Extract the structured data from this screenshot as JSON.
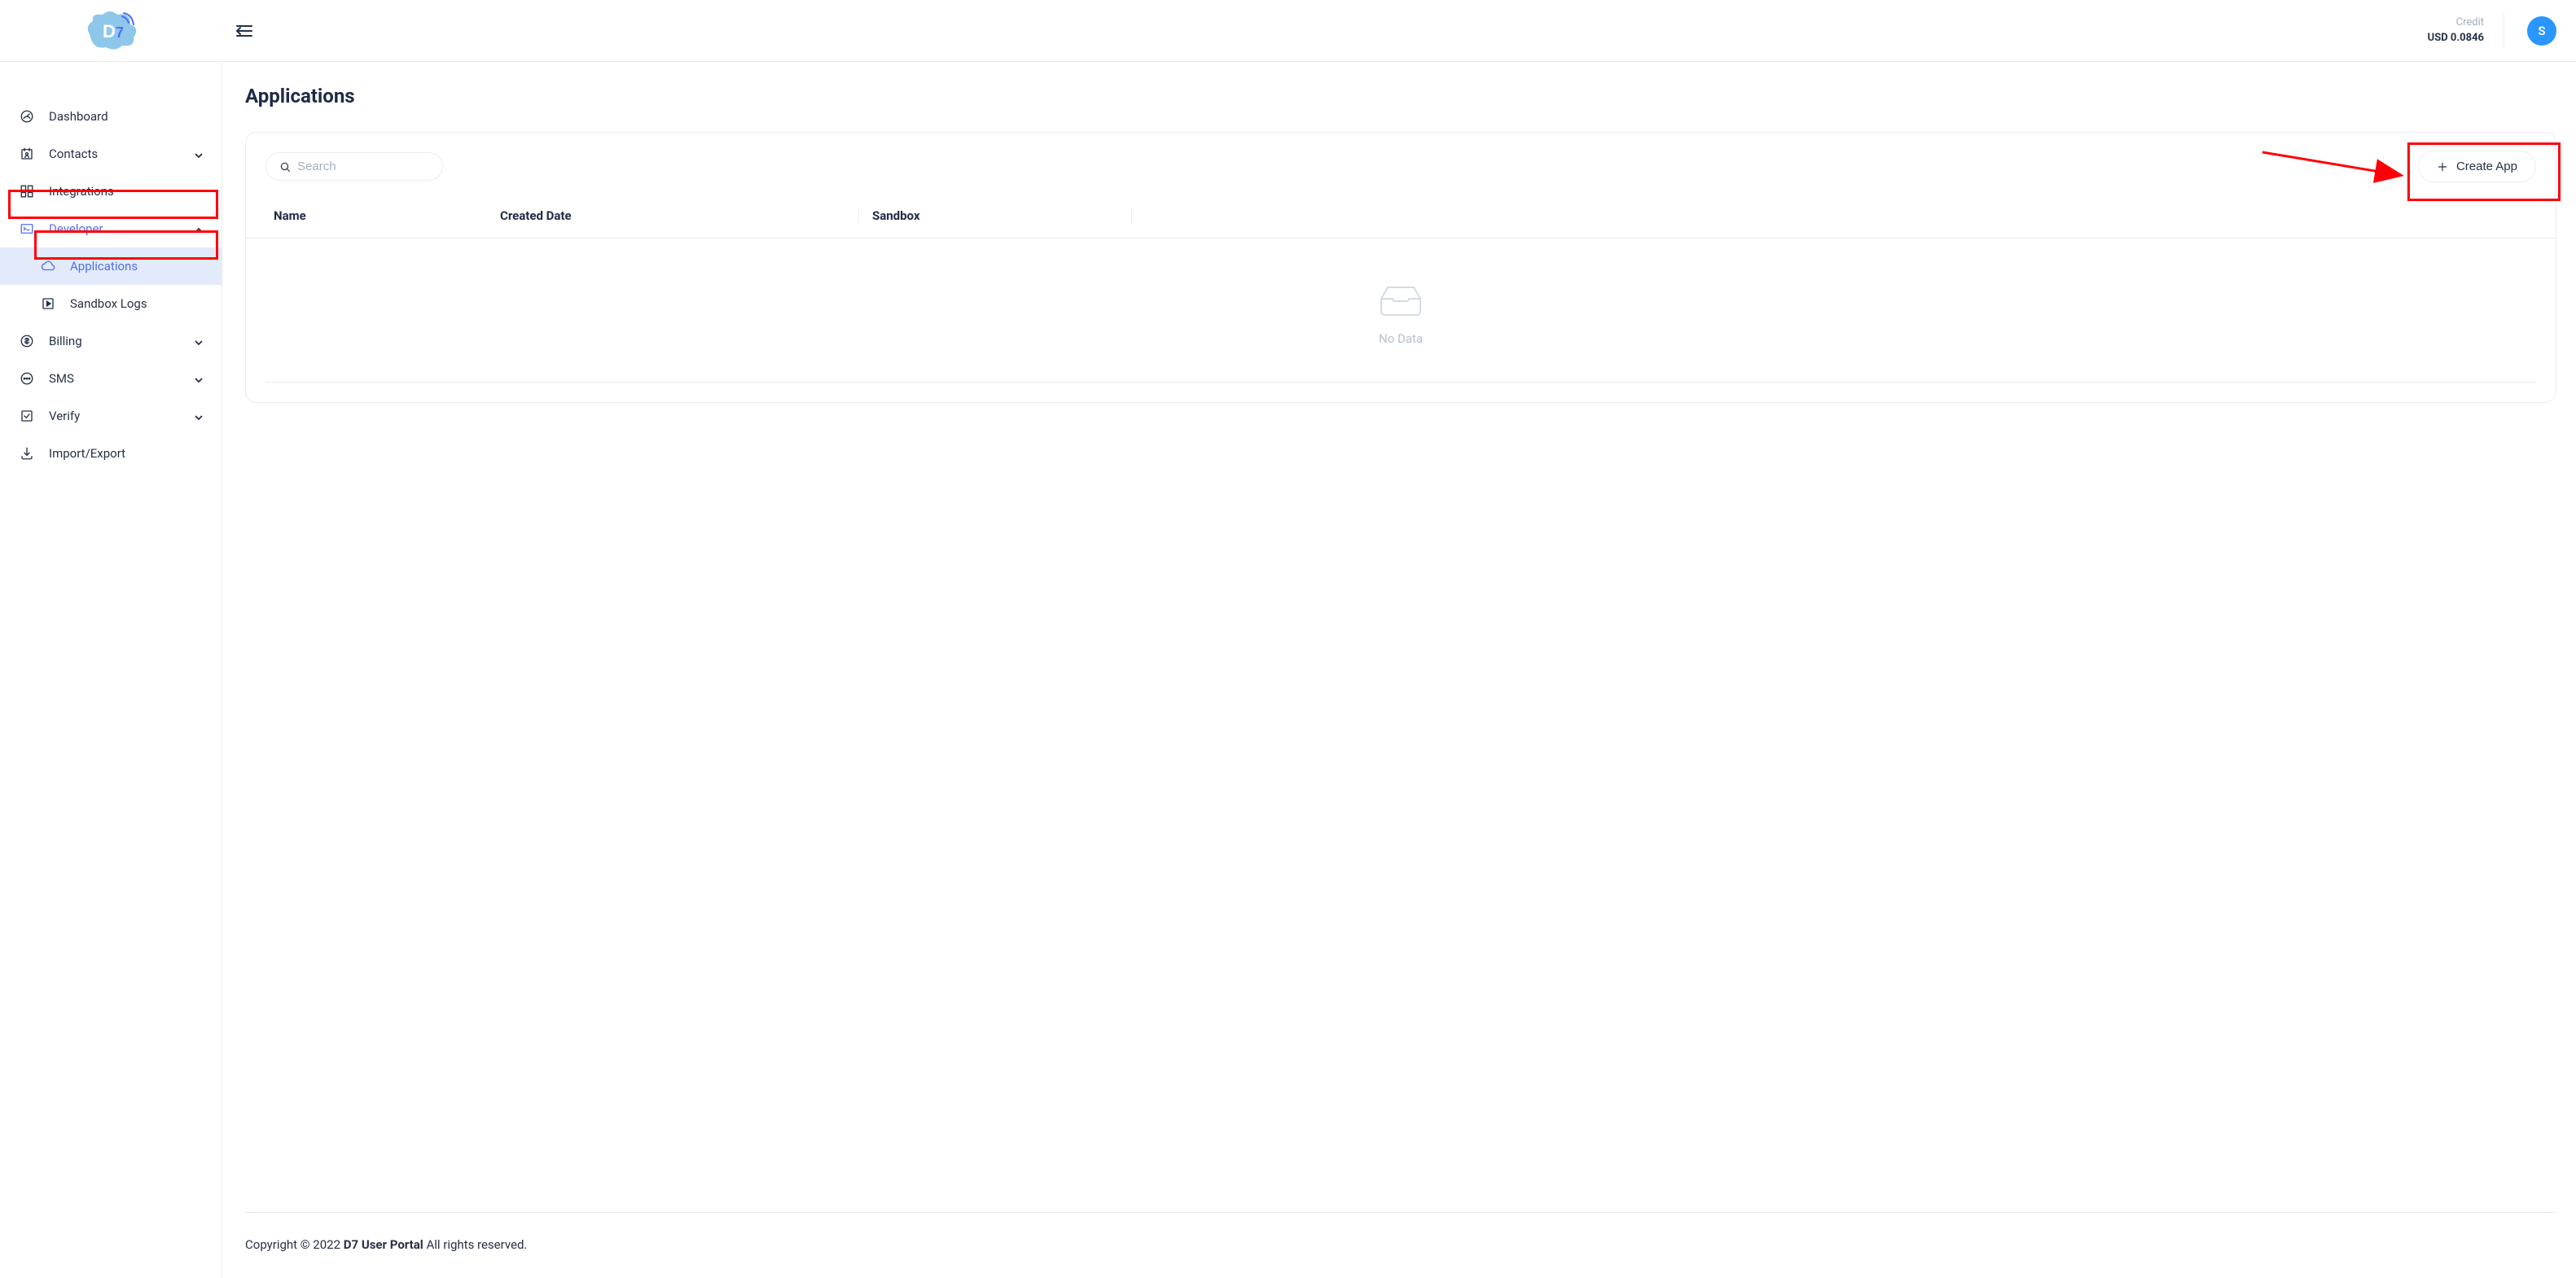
{
  "header": {
    "credit_label": "Credit",
    "credit_value": "USD 0.0846",
    "avatar_initial": "S"
  },
  "sidebar": {
    "items": [
      {
        "label": "Dashboard"
      },
      {
        "label": "Contacts"
      },
      {
        "label": "Integrations"
      },
      {
        "label": "Developer"
      },
      {
        "label": "Billing"
      },
      {
        "label": "SMS"
      },
      {
        "label": "Verify"
      },
      {
        "label": "Import/Export"
      }
    ],
    "developer_children": [
      {
        "label": "Applications"
      },
      {
        "label": "Sandbox Logs"
      }
    ]
  },
  "main": {
    "title": "Applications",
    "search_placeholder": "Search",
    "create_label": "Create App",
    "columns": {
      "name": "Name",
      "created": "Created Date",
      "sandbox": "Sandbox"
    },
    "empty_text": "No Data"
  },
  "footer": {
    "prefix": "Copyright © 2022 ",
    "brand": "D7 User Portal",
    "suffix": " All rights reserved."
  }
}
